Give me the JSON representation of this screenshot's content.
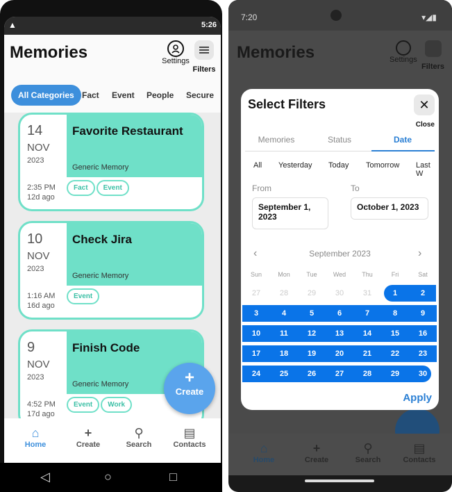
{
  "left_phone": {
    "status_bar": {
      "right_text": "5:26"
    },
    "title": "Memories",
    "settings_label": "Settings",
    "filters_label": "Filters",
    "tabs": [
      "All Categories",
      "Fact",
      "Event",
      "People",
      "Secure"
    ],
    "cards": [
      {
        "day": "14",
        "month": "NOV",
        "year": "2023",
        "title": "Favorite Restaurant",
        "kind": "Generic Memory",
        "time": "2:35 PM",
        "ago": "12d ago",
        "chips": [
          "Fact",
          "Event"
        ]
      },
      {
        "day": "10",
        "month": "NOV",
        "year": "2023",
        "title": "Check Jira",
        "kind": "Generic Memory",
        "time": "1:16 AM",
        "ago": "16d ago",
        "chips": [
          "Event"
        ]
      },
      {
        "day": "9",
        "month": "NOV",
        "year": "2023",
        "title": "Finish Code",
        "kind": "Generic Memory",
        "time": "4:52 PM",
        "ago": "17d ago",
        "chips": [
          "Event",
          "Work"
        ]
      }
    ],
    "fab": {
      "plus": "+",
      "label": "Create"
    },
    "bottom_nav": [
      {
        "label": "Home",
        "icon": "home-icon"
      },
      {
        "label": "Create",
        "icon": "plus-icon"
      },
      {
        "label": "Search",
        "icon": "search-icon"
      },
      {
        "label": "Contacts",
        "icon": "contacts-icon"
      }
    ]
  },
  "right_phone": {
    "status_bar": {
      "time": "7:20"
    },
    "title": "Memories",
    "settings_label": "Settings",
    "filters_label": "Filters",
    "modal": {
      "title": "Select Filters",
      "close_label": "Close",
      "tabs": [
        "Memories",
        "Status",
        "Date"
      ],
      "quick_filters": [
        "All",
        "Yesterday",
        "Today",
        "Tomorrow",
        "Last W"
      ],
      "from_label": "From",
      "from_value": "September 1, 2023",
      "to_label": "To",
      "to_value": "October 1, 2023",
      "calendar_month": "September 2023",
      "weekdays": [
        "Sun",
        "Mon",
        "Tue",
        "Wed",
        "Thu",
        "Fri",
        "Sat"
      ],
      "weeks": [
        [
          "27",
          "28",
          "29",
          "30",
          "31",
          "1",
          "2"
        ],
        [
          "3",
          "4",
          "5",
          "6",
          "7",
          "8",
          "9"
        ],
        [
          "10",
          "11",
          "12",
          "13",
          "14",
          "15",
          "16"
        ],
        [
          "17",
          "18",
          "19",
          "20",
          "21",
          "22",
          "23"
        ],
        [
          "24",
          "25",
          "26",
          "27",
          "28",
          "29",
          "30"
        ]
      ],
      "apply_label": "Apply"
    },
    "bottom_nav": [
      "Home",
      "Create",
      "Search",
      "Contacts"
    ]
  },
  "colors": {
    "accent": "#3d8fdc",
    "card_green": "#6fe0c8",
    "selection_blue": "#0a74e8"
  }
}
